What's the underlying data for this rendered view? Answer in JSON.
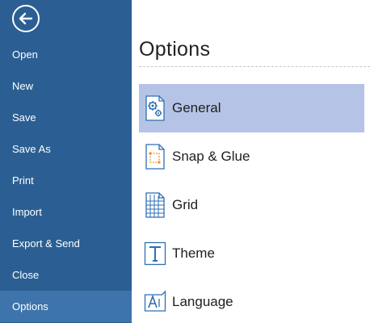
{
  "sidebar": {
    "back_icon": "back-arrow-icon",
    "items": [
      {
        "label": "Open"
      },
      {
        "label": "New"
      },
      {
        "label": "Save"
      },
      {
        "label": "Save As"
      },
      {
        "label": "Print"
      },
      {
        "label": "Import"
      },
      {
        "label": "Export & Send"
      },
      {
        "label": "Close"
      },
      {
        "label": "Options",
        "active": true
      }
    ],
    "colors": {
      "background": "#2b5f93",
      "active": "#3d74ab",
      "text": "#ffffff"
    }
  },
  "main": {
    "title": "Options",
    "options": [
      {
        "label": "General",
        "icon": "general-settings-icon",
        "selected": true
      },
      {
        "label": "Snap & Glue",
        "icon": "snap-glue-icon"
      },
      {
        "label": "Grid",
        "icon": "grid-icon"
      },
      {
        "label": "Theme",
        "icon": "theme-icon"
      },
      {
        "label": "Language",
        "icon": "language-icon"
      }
    ],
    "colors": {
      "selected": "#b5c4e6",
      "icon": "#2e6eb5"
    }
  }
}
